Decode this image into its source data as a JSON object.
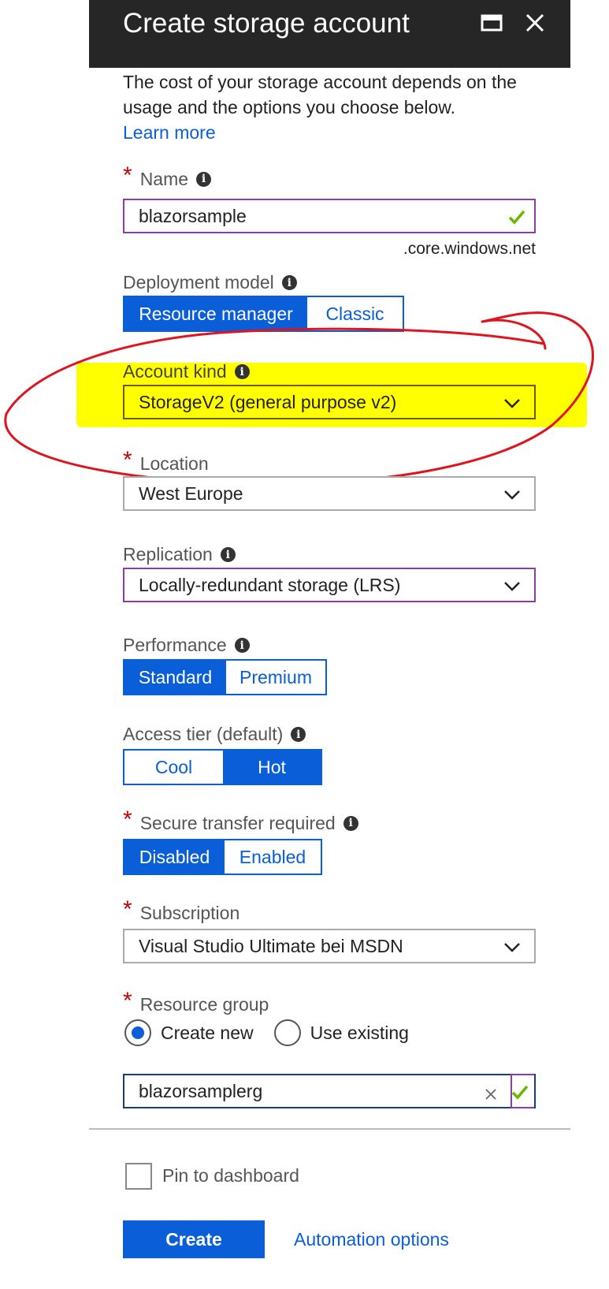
{
  "header": {
    "title": "Create storage account"
  },
  "intro": {
    "text": "The cost of your storage account depends on the usage and the options you choose below.",
    "learn_more": "Learn more"
  },
  "name": {
    "label": "Name",
    "value": "blazorsample",
    "suffix": ".core.windows.net"
  },
  "deployment": {
    "label": "Deployment model",
    "options": [
      "Resource manager",
      "Classic"
    ],
    "selected": "Resource manager"
  },
  "account_kind": {
    "label": "Account kind",
    "value": "StorageV2 (general purpose v2)"
  },
  "location": {
    "label": "Location",
    "value": "West Europe"
  },
  "replication": {
    "label": "Replication",
    "value": "Locally-redundant storage (LRS)"
  },
  "performance": {
    "label": "Performance",
    "options": [
      "Standard",
      "Premium"
    ],
    "selected": "Standard"
  },
  "access_tier": {
    "label": "Access tier (default)",
    "options": [
      "Cool",
      "Hot"
    ],
    "selected": "Hot"
  },
  "secure_transfer": {
    "label": "Secure transfer required",
    "options": [
      "Disabled",
      "Enabled"
    ],
    "selected": "Disabled"
  },
  "subscription": {
    "label": "Subscription",
    "value": "Visual Studio Ultimate bei MSDN"
  },
  "resource_group": {
    "label": "Resource group",
    "options": [
      "Create new",
      "Use existing"
    ],
    "selected": "Create new",
    "value": "blazorsamplerg"
  },
  "footer": {
    "pin_label": "Pin to dashboard",
    "pinned": false,
    "create": "Create",
    "automation": "Automation options"
  },
  "colors": {
    "accent": "#0a5ed7",
    "titlebar": "#262626",
    "highlight": "#ffff00",
    "annotation": "#e0141e",
    "valid_check": "#6bb700",
    "required": "#cc0000"
  },
  "icons": [
    "maximize-icon",
    "close-icon",
    "info-icon",
    "chevron-down-icon",
    "checkmark-icon",
    "clear-icon"
  ]
}
